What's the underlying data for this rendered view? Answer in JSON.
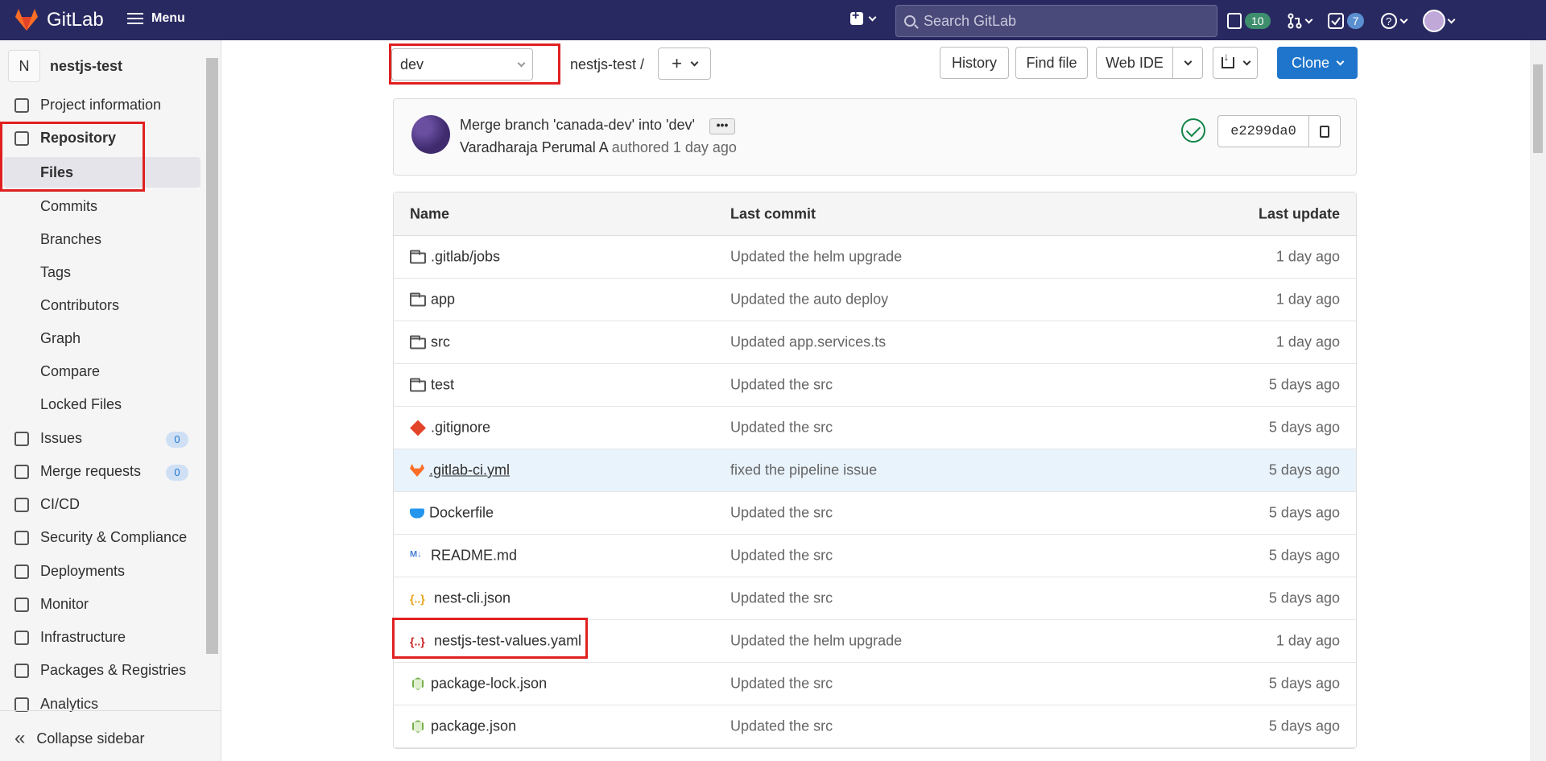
{
  "topbar": {
    "brand": "GitLab",
    "menu_label": "Menu",
    "search_placeholder": "Search GitLab",
    "issues_count": "10",
    "todos_count": "7"
  },
  "sidebar": {
    "project_initial": "N",
    "project_name": "nestjs-test",
    "items": {
      "project_information": "Project information",
      "repository": "Repository",
      "files": "Files",
      "commits": "Commits",
      "branches": "Branches",
      "tags": "Tags",
      "contributors": "Contributors",
      "graph": "Graph",
      "compare": "Compare",
      "locked_files": "Locked Files",
      "issues": "Issues",
      "issues_count": "0",
      "merge_requests": "Merge requests",
      "merge_requests_count": "0",
      "cicd": "CI/CD",
      "security": "Security & Compliance",
      "deployments": "Deployments",
      "monitor": "Monitor",
      "infrastructure": "Infrastructure",
      "packages": "Packages & Registries",
      "analytics": "Analytics"
    },
    "collapse_label": "Collapse sidebar"
  },
  "toolbar": {
    "branch": "dev",
    "breadcrumb": "nestjs-test  /",
    "history": "History",
    "find_file": "Find file",
    "web_ide": "Web IDE",
    "clone": "Clone"
  },
  "commit": {
    "title": "Merge branch 'canada-dev' into 'dev'",
    "author": "Varadharaja Perumal A",
    "authored": "authored 1 day ago",
    "sha": "e2299da0"
  },
  "table": {
    "headers": {
      "name": "Name",
      "last_commit": "Last commit",
      "last_update": "Last update"
    },
    "rows": [
      {
        "name": ".gitlab/jobs",
        "commit": "Updated the helm upgrade",
        "updated": "1 day ago",
        "icon": "folder-icon"
      },
      {
        "name": "app",
        "commit": "Updated the auto deploy",
        "updated": "1 day ago",
        "icon": "folder-icon"
      },
      {
        "name": "src",
        "commit": "Updated app.services.ts",
        "updated": "1 day ago",
        "icon": "folder-icon"
      },
      {
        "name": "test",
        "commit": "Updated the src",
        "updated": "5 days ago",
        "icon": "folder-icon"
      },
      {
        "name": ".gitignore",
        "commit": "Updated the src",
        "updated": "5 days ago",
        "icon": "git-icon"
      },
      {
        "name": ".gitlab-ci.yml",
        "commit": "fixed the pipeline issue",
        "updated": "5 days ago",
        "icon": "gitlab-icon"
      },
      {
        "name": "Dockerfile",
        "commit": "Updated the src",
        "updated": "5 days ago",
        "icon": "docker-icon"
      },
      {
        "name": "README.md",
        "commit": "Updated the src",
        "updated": "5 days ago",
        "icon": "markdown-icon"
      },
      {
        "name": "nest-cli.json",
        "commit": "Updated the src",
        "updated": "5 days ago",
        "icon": "json-icon"
      },
      {
        "name": "nestjs-test-values.yaml",
        "commit": "Updated the helm upgrade",
        "updated": "1 day ago",
        "icon": "yaml-icon"
      },
      {
        "name": "package-lock.json",
        "commit": "Updated the src",
        "updated": "5 days ago",
        "icon": "node-icon"
      },
      {
        "name": "package.json",
        "commit": "Updated the src",
        "updated": "5 days ago",
        "icon": "node-icon"
      }
    ]
  },
  "colors": {
    "nav_bg": "#292961",
    "primary": "#1f75cb",
    "highlight": "#e02020",
    "success": "#108548"
  }
}
